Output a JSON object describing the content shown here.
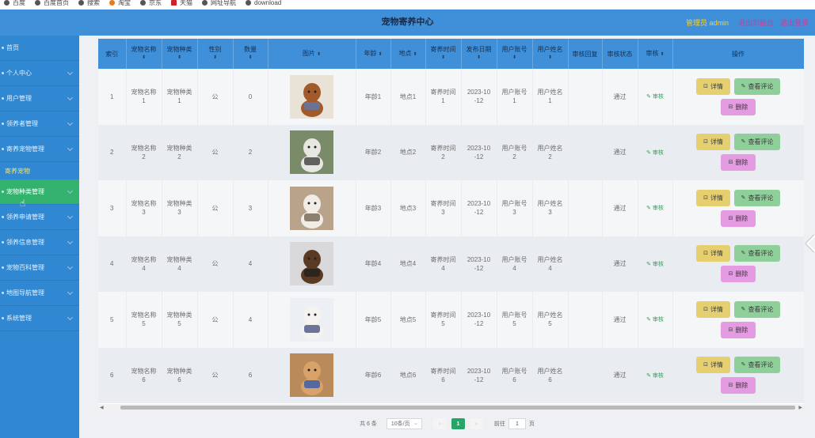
{
  "bookmarks": [
    {
      "label": "百度",
      "icon": "paw-icon"
    },
    {
      "label": "百度首页",
      "icon": "globe-icon"
    },
    {
      "label": "搜索",
      "icon": "globe-icon"
    },
    {
      "label": "淘宝",
      "icon": "taobao-icon"
    },
    {
      "label": "京东",
      "icon": "globe-icon"
    },
    {
      "label": "天猫",
      "icon": "tmall-icon"
    },
    {
      "label": "网址导航",
      "icon": "globe-icon"
    },
    {
      "label": "download",
      "icon": "globe-icon"
    }
  ],
  "header": {
    "title": "宠物寄养中心",
    "admin": "管理员 admin",
    "link1": "退出到前台",
    "link2": "退出登录",
    "bg": "#3f8fd9"
  },
  "sidebar": {
    "items": [
      {
        "label": "首页"
      },
      {
        "label": "个人中心"
      },
      {
        "label": "用户管理"
      },
      {
        "label": "领养者管理"
      },
      {
        "label": "寄养宠物管理"
      }
    ],
    "sub": "寄养宠物",
    "active": "宠物种类管理",
    "items2": [
      {
        "label": "领养申请管理"
      },
      {
        "label": "领养信息管理"
      },
      {
        "label": "宠物百科管理"
      },
      {
        "label": "地图导航管理"
      },
      {
        "label": "系统管理"
      }
    ]
  },
  "table": {
    "headers": [
      "索引",
      "宠物名称",
      "宠物种类",
      "性别",
      "数量",
      "图片",
      "年龄",
      "地点",
      "寄养时间",
      "发布日期",
      "用户账号",
      "用户姓名",
      "审核回复",
      "审核状态",
      "审核",
      "操作"
    ],
    "rows": [
      {
        "idx": "1",
        "name": "宠物名称\n1",
        "kind": "宠物种类\n1",
        "sex": "公",
        "qty": "0",
        "age": "年龄1",
        "place": "地点1",
        "time": "寄养时间\n1",
        "date": "2023-10\n-12",
        "acct": "用户账号\n1",
        "uname": "用户姓名\n1",
        "reply": "",
        "status": "通过",
        "img": "dog-brown"
      },
      {
        "idx": "2",
        "name": "宠物名称\n2",
        "kind": "宠物种类\n2",
        "sex": "公",
        "qty": "2",
        "age": "年龄2",
        "place": "地点2",
        "time": "寄养时间\n2",
        "date": "2023-10\n-12",
        "acct": "用户账号\n2",
        "uname": "用户姓名\n2",
        "reply": "",
        "status": "通过",
        "img": "dog-sheepdog"
      },
      {
        "idx": "3",
        "name": "宠物名称\n3",
        "kind": "宠物种类\n3",
        "sex": "公",
        "qty": "3",
        "age": "年龄3",
        "place": "地点3",
        "time": "寄养时间\n3",
        "date": "2023-10\n-12",
        "acct": "用户账号\n3",
        "uname": "用户姓名\n3",
        "reply": "",
        "status": "通过",
        "img": "cat"
      },
      {
        "idx": "4",
        "name": "宠物名称\n4",
        "kind": "宠物种类\n4",
        "sex": "公",
        "qty": "4",
        "age": "年龄4",
        "place": "地点4",
        "time": "寄养时间\n4",
        "date": "2023-10\n-12",
        "acct": "用户账号\n4",
        "uname": "用户姓名\n4",
        "reply": "",
        "status": "通过",
        "img": "dog-shepherd"
      },
      {
        "idx": "5",
        "name": "宠物名称\n5",
        "kind": "宠物种类\n5",
        "sex": "公",
        "qty": "4",
        "age": "年龄5",
        "place": "地点5",
        "time": "寄养时间\n5",
        "date": "2023-10\n-12",
        "acct": "用户账号\n5",
        "uname": "用户姓名\n5",
        "reply": "",
        "status": "通过",
        "img": "dog-white"
      },
      {
        "idx": "6",
        "name": "宠物名称\n6",
        "kind": "宠物种类\n6",
        "sex": "公",
        "qty": "6",
        "age": "年龄6",
        "place": "地点6",
        "time": "寄养时间\n6",
        "date": "2023-10\n-12",
        "acct": "用户账号\n6",
        "uname": "用户姓名\n6",
        "reply": "",
        "status": "通过",
        "img": "dog-ball"
      }
    ],
    "audit_label": "审核",
    "detail_label": "详情",
    "comment_label": "查看评论",
    "delete_label": "删除"
  },
  "pager": {
    "total": "共 6 条",
    "size": "10条/页",
    "current": "1",
    "goto_pre": "前往",
    "goto_val": "1",
    "goto_post": "页"
  }
}
